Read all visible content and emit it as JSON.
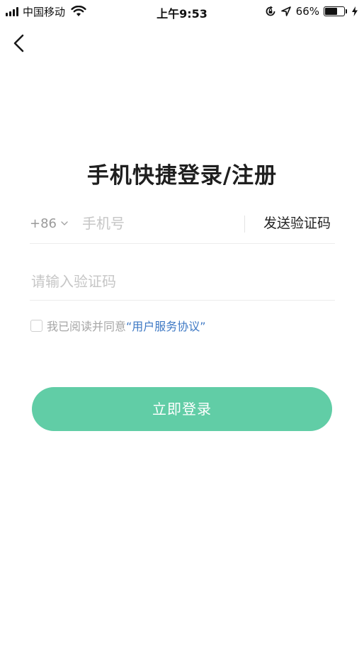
{
  "status_bar": {
    "carrier": "中国移动",
    "time": "上午9:53",
    "battery_percent": "66%",
    "battery_level": 0.66,
    "icons": [
      "signal-icon",
      "wifi-icon",
      "rotation-lock-icon",
      "location-arrow-icon",
      "battery-icon",
      "charging-bolt-icon"
    ]
  },
  "nav": {
    "back_icon": "chevron-left-icon"
  },
  "page": {
    "title": "手机快捷登录/注册"
  },
  "phone": {
    "country_code": "+86",
    "placeholder": "手机号",
    "value": "",
    "send_code_label": "发送验证码"
  },
  "code": {
    "placeholder": "请输入验证码",
    "value": ""
  },
  "agreement": {
    "checked": false,
    "text": "我已阅读并同意",
    "link": "“用户服务协议”"
  },
  "login": {
    "label": "立即登录"
  },
  "colors": {
    "primary": "#61cda6",
    "link": "#3d78c4",
    "placeholder": "#c6c6c6",
    "muted": "#a6a6a6"
  }
}
